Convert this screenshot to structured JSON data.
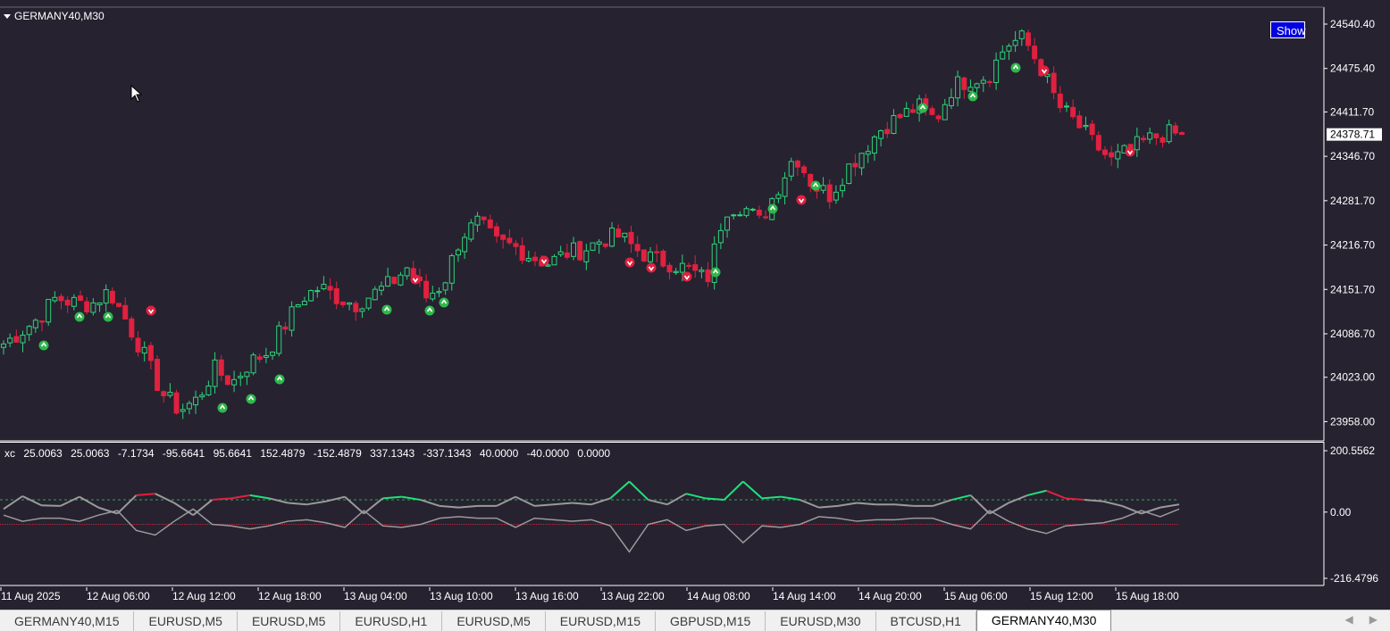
{
  "chart": {
    "symbol": "GERMANY40,M30",
    "show_button": "Show",
    "current_price": "24378.71",
    "price_axis": [
      "24540.40",
      "24475.40",
      "24411.70",
      "24346.70",
      "24281.70",
      "24216.70",
      "24151.70",
      "24086.70",
      "24023.00",
      "23958.00"
    ],
    "time_axis": [
      "11 Aug 2025",
      "12 Aug 06:00",
      "12 Aug 12:00",
      "12 Aug 18:00",
      "13 Aug 04:00",
      "13 Aug 10:00",
      "13 Aug 16:00",
      "13 Aug 22:00",
      "14 Aug 08:00",
      "14 Aug 14:00",
      "14 Aug 20:00",
      "15 Aug 06:00",
      "15 Aug 12:00",
      "15 Aug 18:00"
    ],
    "colors": {
      "background": "#262230",
      "bull": "#2fd37a",
      "bear": "#e0213f",
      "grid": "#3a3544"
    }
  },
  "indicator": {
    "name": "xc",
    "values": [
      "25.0063",
      "25.0063",
      "-7.1734",
      "-95.6641",
      "95.6641",
      "152.4879",
      "-152.4879",
      "337.1343",
      "-337.1343",
      "40.0000",
      "-40.0000",
      "0.0000"
    ],
    "axis": [
      "200.5562",
      "0.00",
      "-216.4796"
    ]
  },
  "tabs": [
    {
      "label": "GERMANY40,M15",
      "active": false
    },
    {
      "label": "EURUSD,M5",
      "active": false
    },
    {
      "label": "EURUSD,M5",
      "active": false
    },
    {
      "label": "EURUSD,H1",
      "active": false
    },
    {
      "label": "EURUSD,M5",
      "active": false
    },
    {
      "label": "EURUSD,M15",
      "active": false
    },
    {
      "label": "GBPUSD,M15",
      "active": false
    },
    {
      "label": "EURUSD,M30",
      "active": false
    },
    {
      "label": "BTCUSD,H1",
      "active": false
    },
    {
      "label": "GERMANY40,M30",
      "active": true
    }
  ],
  "tab_scroll": {
    "left": "◀",
    "right": "▶"
  },
  "chart_data": {
    "type": "candlestick",
    "path": [
      24072,
      24090,
      24110,
      24140,
      24132,
      24130,
      24150,
      24105,
      24055,
      24000,
      23975,
      23990,
      24035,
      24015,
      24045,
      24060,
      24100,
      24140,
      24155,
      24140,
      24130,
      24145,
      24160,
      24185,
      24140,
      24160,
      24230,
      24250,
      24220,
      24215,
      24200,
      24190,
      24205,
      24210,
      24225,
      24230,
      24210,
      24195,
      24190,
      24180,
      24165,
      24270,
      24275,
      24250,
      24300,
      24350,
      24305,
      24290,
      24330,
      24360,
      24390,
      24405,
      24420,
      24400,
      24450,
      24460,
      24465,
      24510,
      24520,
      24475,
      24420,
      24395,
      24365,
      24340,
      24355,
      24370,
      24380,
      24378.71
    ],
    "markers_up": [
      4,
      7,
      14,
      15,
      18,
      22,
      26,
      27,
      34,
      38,
      41,
      49
    ],
    "markers_down": [
      8,
      23,
      30,
      34,
      35,
      38,
      42,
      56,
      60
    ],
    "indicator_series": {
      "green_red": [
        10,
        52,
        22,
        20,
        50,
        15,
        -5,
        55,
        60,
        30,
        -10,
        40,
        45,
        55,
        45,
        30,
        25,
        35,
        50,
        -5,
        45,
        50,
        40,
        20,
        15,
        20,
        20,
        50,
        20,
        25,
        30,
        25,
        45,
        100,
        40,
        25,
        60,
        45,
        40,
        100,
        45,
        50,
        40,
        15,
        20,
        30,
        25,
        25,
        20,
        20,
        40,
        55,
        -5,
        30,
        55,
        70,
        45,
        40,
        35,
        20,
        -5,
        15,
        25
      ],
      "gray": [
        -10,
        -30,
        -20,
        -20,
        -30,
        -10,
        5,
        -60,
        -75,
        -30,
        10,
        -40,
        -45,
        -55,
        -45,
        -30,
        -25,
        -35,
        -50,
        5,
        -45,
        -50,
        -40,
        -20,
        -15,
        -20,
        -20,
        -50,
        -20,
        -25,
        -30,
        -25,
        -45,
        -130,
        -40,
        -25,
        -60,
        -45,
        -40,
        -100,
        -45,
        -50,
        -40,
        -15,
        -20,
        -30,
        -25,
        -25,
        -20,
        -20,
        -40,
        -55,
        5,
        -30,
        -55,
        -70,
        -45,
        -40,
        -35,
        -20,
        5,
        -15,
        10
      ]
    }
  }
}
